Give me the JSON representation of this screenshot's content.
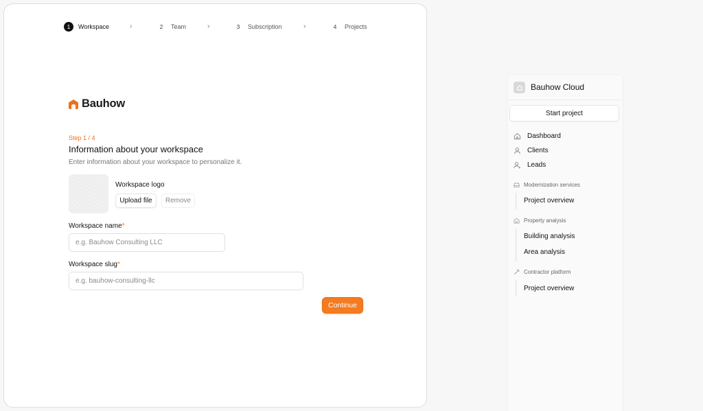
{
  "stepper": {
    "steps": [
      {
        "num": "1",
        "label": "Workspace"
      },
      {
        "num": "2",
        "label": "Team"
      },
      {
        "num": "3",
        "label": "Subscription"
      },
      {
        "num": "4",
        "label": "Projects"
      }
    ],
    "active_step": 1
  },
  "brand": {
    "name": "Bauhow",
    "accent": "#f06f1c"
  },
  "form": {
    "step_label": "Step 1 / 4",
    "title": "Information about your workspace",
    "subtitle": "Enter information about your workspace to personalize it.",
    "logo_label": "Workspace logo",
    "upload_label": "Upload file",
    "remove_label": "Remove",
    "name_label": "Workspace name",
    "name_placeholder": "e.g. Bauhow Consulting LLC",
    "name_value": "",
    "slug_label": "Workspace slug",
    "slug_placeholder": "e.g. bauhow-consulting-llc",
    "slug_value": "",
    "required_mark": "*",
    "continue_label": "Continue"
  },
  "sidebar": {
    "title": "Bauhow Cloud",
    "start_label": "Start project",
    "nav": [
      {
        "label": "Dashboard",
        "icon": "home-icon"
      },
      {
        "label": "Clients",
        "icon": "user-icon"
      },
      {
        "label": "Leads",
        "icon": "user-plus-icon"
      }
    ],
    "groups": [
      {
        "label": "Modernization services",
        "icon": "building-icon",
        "items": [
          "Project overview"
        ]
      },
      {
        "label": "Property analysis",
        "icon": "house-icon",
        "items": [
          "Building analysis",
          "Area analysis"
        ]
      },
      {
        "label": "Contractor platform",
        "icon": "wrench-icon",
        "items": [
          "Project overview"
        ]
      }
    ]
  }
}
